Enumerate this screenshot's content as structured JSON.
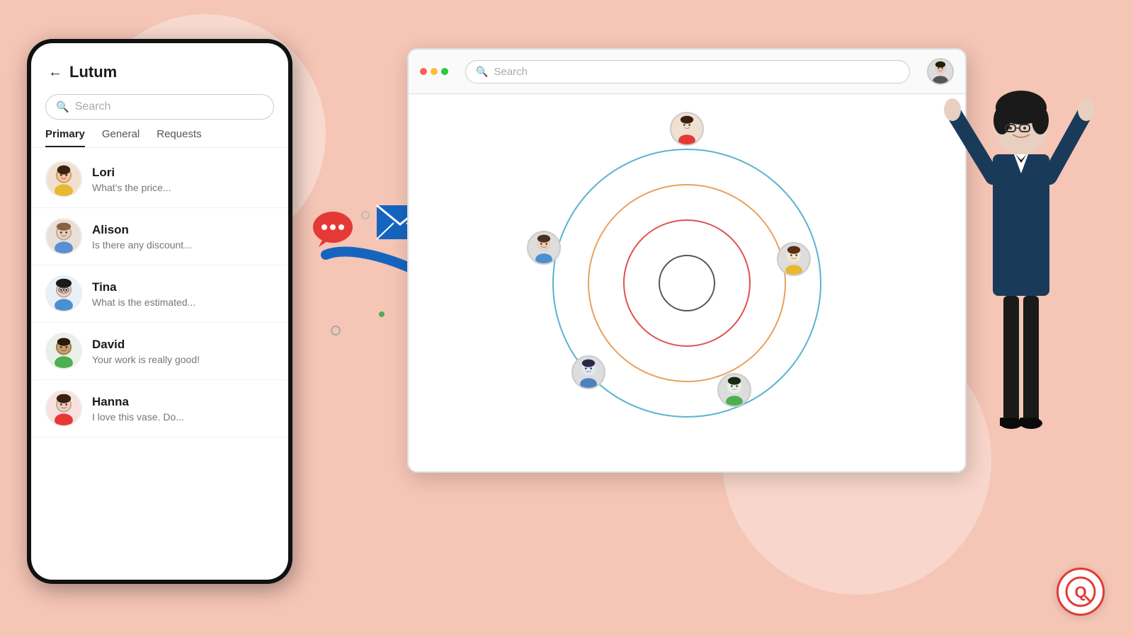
{
  "background": "#f5c5b5",
  "phone": {
    "title": "Lutum",
    "back_arrow": "←",
    "search_placeholder": "Search",
    "tabs": [
      "Primary",
      "General",
      "Requests"
    ],
    "active_tab": "Primary",
    "contacts": [
      {
        "name": "Lori",
        "message": "What's the price...",
        "avatar_color": "#f0e0d0",
        "icon": "👩"
      },
      {
        "name": "Alison",
        "message": "Is there any discount...",
        "avatar_color": "#e8e0d8",
        "icon": "👩"
      },
      {
        "name": "Tina",
        "message": "What is the estimated...",
        "avatar_color": "#e8f0f8",
        "icon": "👩"
      },
      {
        "name": "David",
        "message": "Your work is really good!",
        "avatar_color": "#e8f0e8",
        "icon": "👨"
      },
      {
        "name": "Hanna",
        "message": "I love this vase. Do...",
        "avatar_color": "#f8e0e0",
        "icon": "👩"
      }
    ]
  },
  "browser": {
    "search_placeholder": "Search",
    "toolbar_avatar_icon": "👩",
    "diagram": {
      "ring_colors": [
        "#5bb3d0",
        "#e8a060",
        "#e05050",
        "#555"
      ],
      "contact_avatars": [
        {
          "position": "top",
          "icon": "👩",
          "bg": "#f0e0d0"
        },
        {
          "position": "left",
          "icon": "👩",
          "bg": "#e8f0f8"
        },
        {
          "position": "right",
          "icon": "👩",
          "bg": "#f0f0e0"
        },
        {
          "position": "bottom-left",
          "icon": "👩",
          "bg": "#e0e8f0"
        },
        {
          "position": "bottom-right",
          "icon": "👨",
          "bg": "#e8f0e8"
        }
      ]
    }
  },
  "floating_icons": {
    "chat_bubble": "💬",
    "envelope": "✉",
    "phone": "📞"
  },
  "decorations": {
    "star_gold": "★",
    "star_red": "★",
    "logo_text": "Q"
  }
}
